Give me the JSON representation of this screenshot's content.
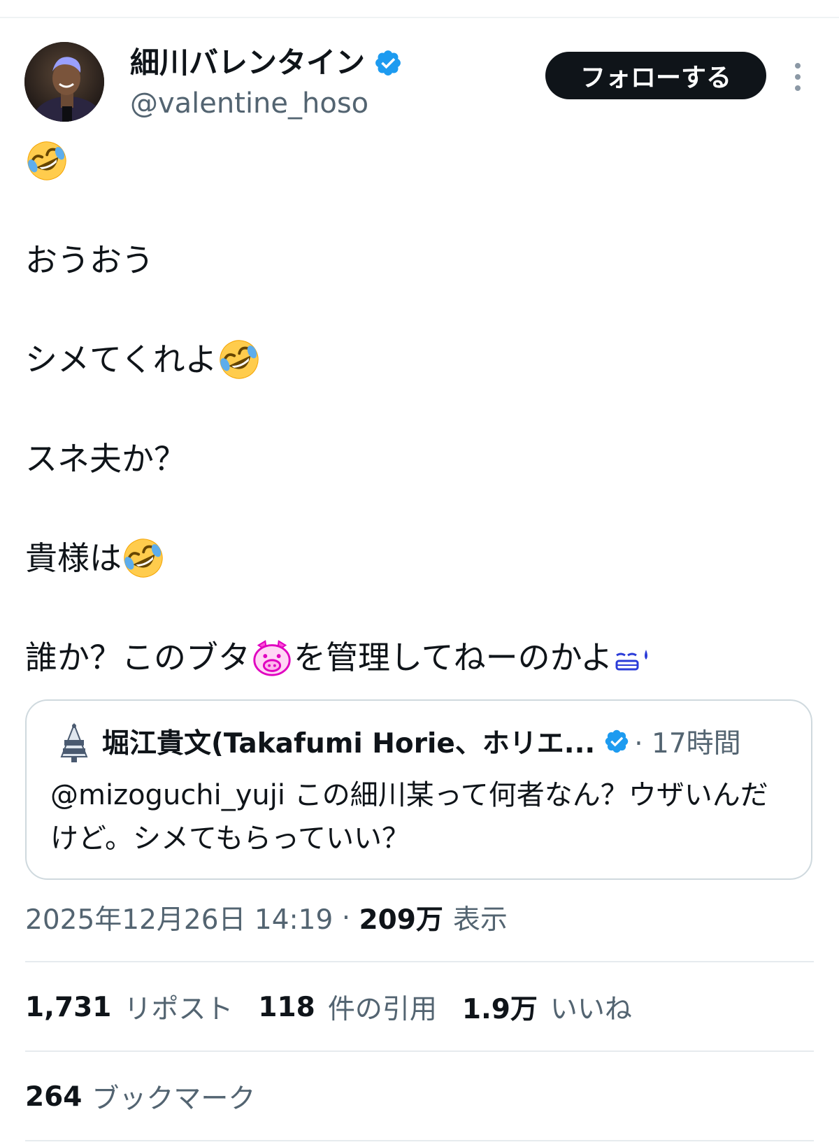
{
  "author": {
    "display_name": "細川バレンタイン",
    "handle": "@valentine_hoso",
    "verified_color": "#1d9bf0"
  },
  "actions": {
    "follow_label": "フォローする",
    "more_icon": "more-vertical-icon"
  },
  "tweet": {
    "lines": [
      "",
      "おうおう",
      "シメてくれよ",
      "スネ夫か？",
      "貴様は",
      "誰か？このブタ",
      "を管理してねーのかよ"
    ],
    "emojis": [
      "rolling-on-floor-laughing",
      "pig-face",
      "sweat-face"
    ]
  },
  "quote": {
    "author": "堀江貴文(Takafumi Horie、ホリエ...",
    "time": "· 17時間",
    "text": "@mizoguchi_yuji この細川某って何者なん？ウザいんだけど。シメてもらっていい？"
  },
  "meta": {
    "datetime": "2025年12月26日 14:19",
    "separator": " · ",
    "views": "209万",
    "views_label": "表示"
  },
  "stats": {
    "reposts": "1,731",
    "reposts_label": "リポスト",
    "quotes": "118",
    "quotes_label": "件の引用",
    "likes": "1.9万",
    "likes_label": "いいね",
    "bookmarks": "264",
    "bookmarks_label": "ブックマーク"
  }
}
